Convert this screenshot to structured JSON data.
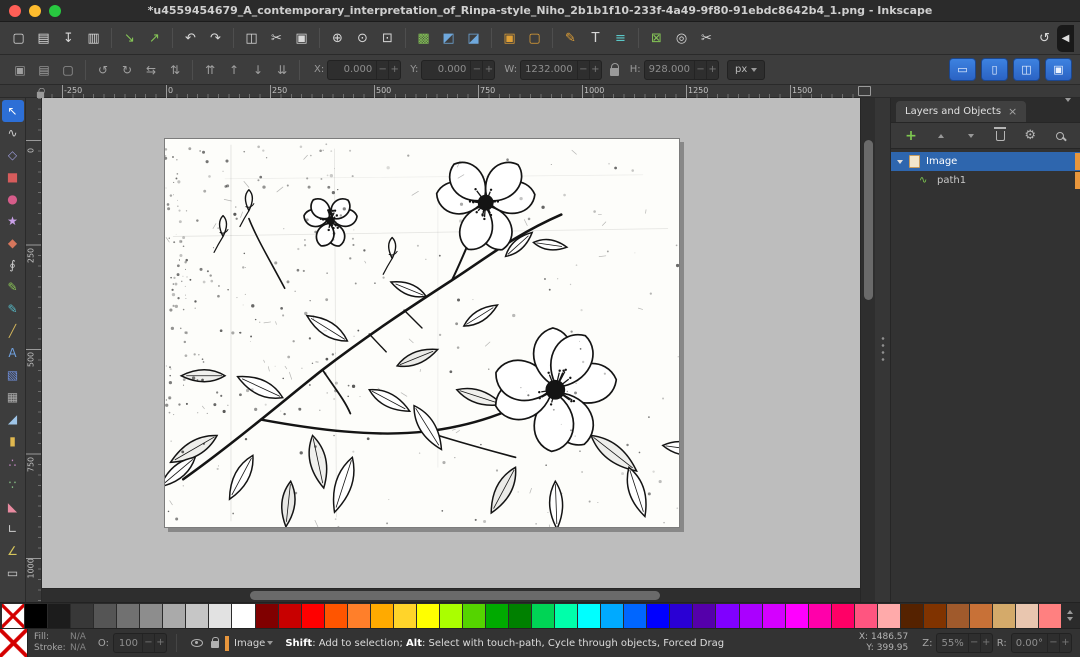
{
  "window": {
    "title": "*u4559454679_A_contemporary_interpretation_of_Rinpa-style_Niho_2b1b1f10-233f-4a49-9f80-91ebdc8642b4_1.png - Inkscape"
  },
  "ui": {
    "minus": "−",
    "plus": "+",
    "tab_close": "×",
    "path_icon_glyph": "∿"
  },
  "command_bar": {
    "groups": [
      [
        {
          "name": "new-document",
          "glyph": "▢",
          "color": "#d8d8d8"
        },
        {
          "name": "open-document",
          "glyph": "▤",
          "color": "#d8d8d8"
        },
        {
          "name": "save-document",
          "glyph": "↧",
          "color": "#d8d8d8"
        },
        {
          "name": "print-document",
          "glyph": "▥",
          "color": "#d8d8d8"
        }
      ],
      [
        {
          "name": "import",
          "glyph": "↘",
          "color": "#85c556"
        },
        {
          "name": "export",
          "glyph": "↗",
          "color": "#85c556"
        }
      ],
      [
        {
          "name": "undo",
          "glyph": "↶",
          "color": "#d8d8d8"
        },
        {
          "name": "redo",
          "glyph": "↷",
          "color": "#d8d8d8"
        }
      ],
      [
        {
          "name": "copy",
          "glyph": "◫",
          "color": "#d8d8d8"
        },
        {
          "name": "cut",
          "glyph": "✂",
          "color": "#d8d8d8"
        },
        {
          "name": "paste",
          "glyph": "▣",
          "color": "#d8d8d8"
        }
      ],
      [
        {
          "name": "zoom-to-selection",
          "glyph": "⊕",
          "color": "#d8d8d8"
        },
        {
          "name": "zoom-to-drawing",
          "glyph": "⊙",
          "color": "#d8d8d8"
        },
        {
          "name": "zoom-to-page",
          "glyph": "⊡",
          "color": "#d8d8d8"
        }
      ],
      [
        {
          "name": "duplicate",
          "glyph": "▩",
          "color": "#85c556"
        },
        {
          "name": "create-clone",
          "glyph": "◩",
          "color": "#6fa8dc"
        },
        {
          "name": "unlink-clone",
          "glyph": "◪",
          "color": "#6fa8dc"
        }
      ],
      [
        {
          "name": "group-objects",
          "glyph": "▣",
          "color": "#e0a036"
        },
        {
          "name": "ungroup-objects",
          "glyph": "▢",
          "color": "#e0a036"
        }
      ],
      [
        {
          "name": "fill-stroke-dialog",
          "glyph": "✎",
          "color": "#e0a036"
        },
        {
          "name": "text-dialog",
          "glyph": "T",
          "color": "#d8d8d8"
        },
        {
          "name": "align-distribute-dialog",
          "glyph": "≡",
          "color": "#5bc8c8"
        }
      ],
      [
        {
          "name": "xml-editor",
          "glyph": "⊠",
          "color": "#85c556"
        },
        {
          "name": "find-replace",
          "glyph": "◎",
          "color": "#d8d8d8"
        },
        {
          "name": "node-editor-prefs",
          "glyph": "✂",
          "color": "#d8d8d8"
        }
      ]
    ],
    "right": [
      {
        "name": "snap-controls",
        "glyph": "↺",
        "color": "#d8d8d8"
      },
      {
        "name": "snap-bar-toggle",
        "glyph": "◀",
        "color": "#dddddd"
      }
    ]
  },
  "tool_controls": {
    "select_group": [
      {
        "name": "select-all",
        "glyph": "▣"
      },
      {
        "name": "select-all-layers",
        "glyph": "▤"
      },
      {
        "name": "deselect",
        "glyph": "▢"
      }
    ],
    "transform_group": [
      {
        "name": "rotate-ccw",
        "glyph": "↺"
      },
      {
        "name": "rotate-cw",
        "glyph": "↻"
      },
      {
        "name": "flip-horizontal",
        "glyph": "⇆"
      },
      {
        "name": "flip-vertical",
        "glyph": "⇅"
      }
    ],
    "zorder_group": [
      {
        "name": "raise-to-top",
        "glyph": "⇈"
      },
      {
        "name": "raise",
        "glyph": "↑"
      },
      {
        "name": "lower",
        "glyph": "↓"
      },
      {
        "name": "lower-to-bottom",
        "glyph": "⇊"
      }
    ],
    "fields": [
      {
        "name": "x",
        "label": "X:",
        "value": "0.000"
      },
      {
        "name": "y",
        "label": "Y:",
        "value": "0.000"
      },
      {
        "name": "w",
        "label": "W:",
        "value": "1232.000"
      },
      {
        "name": "h",
        "label": "H:",
        "value": "928.000"
      }
    ],
    "units": "px",
    "toggles": [
      {
        "name": "scale-stroke-toggle",
        "glyph": "▭"
      },
      {
        "name": "scale-corners-toggle",
        "glyph": "▯"
      },
      {
        "name": "move-gradients-toggle",
        "glyph": "◫"
      },
      {
        "name": "move-patterns-toggle",
        "glyph": "▣"
      }
    ]
  },
  "toolbox": {
    "tools": [
      {
        "name": "selector-tool",
        "glyph": "↖",
        "color": "#ffffff",
        "active": true
      },
      {
        "name": "node-tool",
        "glyph": "∿",
        "color": "#cccccc"
      },
      {
        "name": "shape-builder-tool",
        "glyph": "◇",
        "color": "#9b9bd6"
      },
      {
        "name": "rectangle-tool",
        "glyph": "■",
        "color": "#d65c5c"
      },
      {
        "name": "ellipse-tool",
        "glyph": "●",
        "color": "#d65c8a"
      },
      {
        "name": "star-tool",
        "glyph": "★",
        "color": "#c9a0e8"
      },
      {
        "name": "box-3d-tool",
        "glyph": "◆",
        "color": "#d6765c"
      },
      {
        "name": "spiral-tool",
        "glyph": "∮",
        "color": "#cccccc"
      },
      {
        "name": "pencil-tool",
        "glyph": "✎",
        "color": "#8ac556"
      },
      {
        "name": "pen-tool",
        "glyph": "✎",
        "color": "#56b8c5"
      },
      {
        "name": "calligraphy-tool",
        "glyph": "╱",
        "color": "#d6b85c"
      },
      {
        "name": "text-tool",
        "glyph": "A",
        "color": "#6f9fdc"
      },
      {
        "name": "gradient-tool",
        "glyph": "▧",
        "color": "#6f8fdc"
      },
      {
        "name": "mesh-gradient-tool",
        "glyph": "▦",
        "color": "#aaaaaa"
      },
      {
        "name": "dropper-tool",
        "glyph": "◢",
        "color": "#9fc5e8"
      },
      {
        "name": "paint-bucket-tool",
        "glyph": "▮",
        "color": "#e0b84f"
      },
      {
        "name": "tweak-tool",
        "glyph": "∴",
        "color": "#c58ac5"
      },
      {
        "name": "spray-tool",
        "glyph": "∵",
        "color": "#8ac58a"
      },
      {
        "name": "eraser-tool",
        "glyph": "◣",
        "color": "#e88aa0"
      },
      {
        "name": "connector-tool",
        "glyph": "∟",
        "color": "#cccccc"
      },
      {
        "name": "measure-tool",
        "glyph": "∠",
        "color": "#d6c55c"
      },
      {
        "name": "pages-tool",
        "glyph": "▭",
        "color": "#cccccc"
      }
    ]
  },
  "rulers": {
    "horizontal": [
      "-250",
      "0",
      "250",
      "500",
      "750",
      "1000",
      "1250",
      "1500"
    ],
    "vertical": [
      "0",
      "250",
      "500",
      "750",
      "1000"
    ]
  },
  "layers_panel": {
    "tab_title": "Layers and Objects",
    "rows": [
      {
        "label": "Image",
        "kind": "layer",
        "selected": true,
        "expanded": true
      },
      {
        "label": "path1",
        "kind": "path",
        "selected": false
      }
    ]
  },
  "palette": {
    "colors": [
      "none",
      "#000000",
      "#1c1c1c",
      "#383838",
      "#555555",
      "#717171",
      "#8d8d8d",
      "#aaaaaa",
      "#c6c6c6",
      "#e2e2e2",
      "#ffffff",
      "#800000",
      "#c80000",
      "#ff0000",
      "#ff5500",
      "#ff7f2a",
      "#ffaa00",
      "#ffd42a",
      "#ffff00",
      "#aaff00",
      "#55d400",
      "#00aa00",
      "#008000",
      "#00d455",
      "#00ffaa",
      "#00ffff",
      "#00aaff",
      "#0066ff",
      "#0000ff",
      "#2a00d4",
      "#5500aa",
      "#8000ff",
      "#aa00ff",
      "#d400ff",
      "#ff00ff",
      "#ff00aa",
      "#ff0066",
      "#ff5580",
      "#ffaaaa",
      "#552200",
      "#803300",
      "#a05a2c",
      "#c87137",
      "#d4aa6a",
      "#e9c6af",
      "#ff8080"
    ]
  },
  "status_bar": {
    "fill_label": "Fill:",
    "fill_value": "N/A",
    "stroke_label": "Stroke:",
    "stroke_value": "N/A",
    "opacity_label": "O:",
    "opacity_value": "100",
    "layer_name": "Image",
    "hint": {
      "shift": "Shift",
      "shift_text": ": Add to selection; ",
      "alt": "Alt",
      "alt_text": ": Select with touch-path, Cycle through objects, Forced Drag"
    },
    "x_label": "X:",
    "x_value": "1486.57",
    "y_label": "Y:",
    "y_value": "399.95",
    "zoom_label": "Z:",
    "zoom_value": "55%",
    "rotation_label": "R:",
    "rotation_value": "0.00°"
  }
}
